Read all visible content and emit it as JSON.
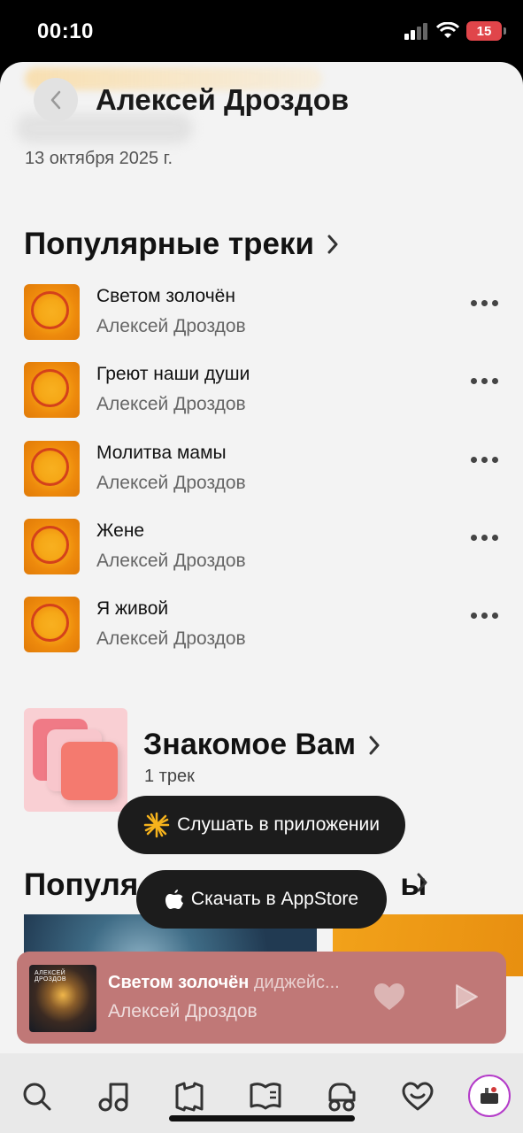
{
  "status": {
    "time": "00:10",
    "battery": "15"
  },
  "header": {
    "title": "Алексей Дроздов",
    "date": "13 октября 2025 г."
  },
  "popular_tracks": {
    "title": "Популярные треки",
    "items": [
      {
        "title": "Светом золочён",
        "artist": "Алексей Дроздов"
      },
      {
        "title": "Греют наши души",
        "artist": "Алексей Дроздов"
      },
      {
        "title": "Молитва мамы",
        "artist": "Алексей Дроздов"
      },
      {
        "title": "Жене",
        "artist": "Алексей Дроздов"
      },
      {
        "title": "Я живой",
        "artist": "Алексей Дроздов"
      }
    ]
  },
  "familiar": {
    "title": "Знакомое Вам",
    "count": "1 трек"
  },
  "popular_albums": {
    "title_visible": "Популя",
    "title_tail": "ы"
  },
  "promo": {
    "listen_in_app": "Слушать в приложении",
    "download_appstore": "Скачать в AppStore"
  },
  "player": {
    "title": "Светом золочён",
    "subtitle": "диджейс...",
    "artist": "Алексей Дроздов",
    "cover_text": "АЛЕКСЕЙ ДРОЗДОВ"
  },
  "tabs": [
    "search-icon",
    "music-note-icon",
    "map-icon",
    "book-icon",
    "kids-car-icon",
    "heart-icon",
    "avatar"
  ],
  "colors": {
    "player_bg": "#c07877",
    "cover_orange": "#f6a817",
    "avatar_ring": "#b43bc9"
  }
}
